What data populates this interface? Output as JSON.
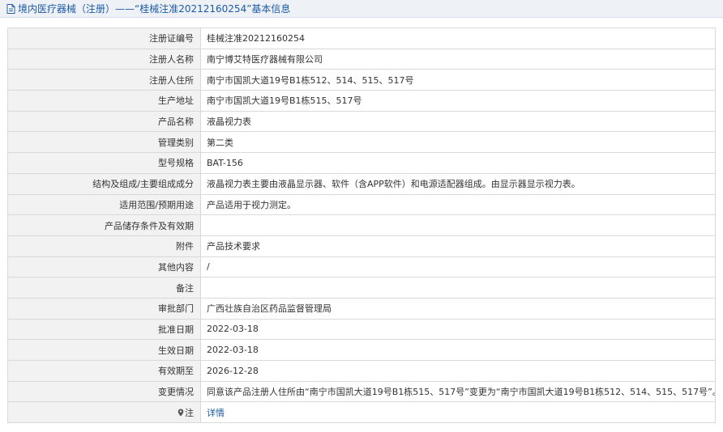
{
  "header": {
    "title": "境内医疗器械（注册）——“桂械注准20212160254”基本信息"
  },
  "rows": [
    {
      "label": "注册证编号",
      "value": "桂械注准20212160254"
    },
    {
      "label": "注册人名称",
      "value": "南宁博艾特医疗器械有限公司"
    },
    {
      "label": "注册人住所",
      "value": "南宁市国凯大道19号B1栋512、514、515、517号"
    },
    {
      "label": "生产地址",
      "value": "南宁市国凯大道19号B1栋515、517号"
    },
    {
      "label": "产品名称",
      "value": "液晶视力表"
    },
    {
      "label": "管理类别",
      "value": "第二类"
    },
    {
      "label": "型号规格",
      "value": "BAT-156"
    },
    {
      "label": "结构及组成/主要组成成分",
      "value": "液晶视力表主要由液晶显示器、软件（含APP软件）和电源适配器组成。由显示器显示视力表。"
    },
    {
      "label": "适用范围/预期用途",
      "value": "产品适用于视力测定。"
    },
    {
      "label": "产品储存条件及有效期",
      "value": ""
    },
    {
      "label": "附件",
      "value": "产品技术要求"
    },
    {
      "label": "其他内容",
      "value": "/"
    },
    {
      "label": "备注",
      "value": ""
    },
    {
      "label": "审批部门",
      "value": "广西壮族自治区药品监督管理局"
    },
    {
      "label": "批准日期",
      "value": "2022-03-18"
    },
    {
      "label": "生效日期",
      "value": "2022-03-18"
    },
    {
      "label": "有效期至",
      "value": "2026-12-28"
    },
    {
      "label": "变更情况",
      "value": "同意该产品注册人住所由“南宁市国凯大道19号B1栋515、517号”变更为“南宁市国凯大道19号B1栋512、514、515、517号”。"
    }
  ],
  "note_row": {
    "label": "注",
    "link_text": "详情",
    "icon": "map-pin-icon"
  }
}
